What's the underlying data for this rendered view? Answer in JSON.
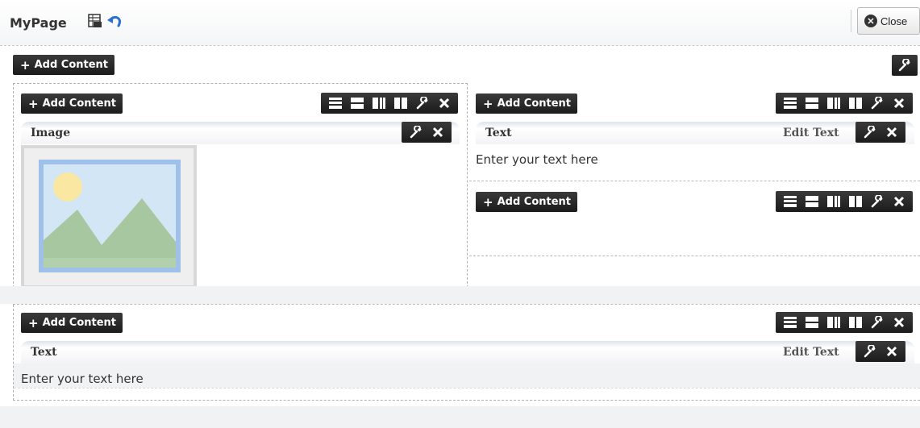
{
  "app": {
    "title": "MyPage",
    "close_label": "Close"
  },
  "labels": {
    "add_content": "Add Content",
    "edit_text": "Edit Text",
    "plus": "+"
  },
  "widgets": {
    "image": {
      "title": "Image"
    },
    "text_top": {
      "title": "Text",
      "body": "Enter your text here"
    },
    "text_bottom": {
      "title": "Text",
      "body": "Enter your text here"
    }
  },
  "icons": {
    "export": "spreadsheet-export-icon",
    "undo": "undo-icon",
    "close": "close-circle-icon",
    "wrench": "wrench-icon",
    "remove": "x-icon",
    "layouts": [
      "layout-rows-icon",
      "layout-stacked-icon",
      "layout-columns-icon",
      "layout-split-icon"
    ]
  },
  "colors": {
    "undo_blue": "#2a6fd1",
    "button_dark": "#222222"
  }
}
